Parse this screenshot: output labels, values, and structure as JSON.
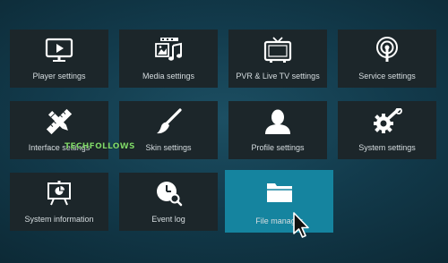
{
  "tiles": [
    {
      "label": "Player settings",
      "icon": "monitor-play-icon"
    },
    {
      "label": "Media settings",
      "icon": "media-icon"
    },
    {
      "label": "PVR & Live TV settings",
      "icon": "tv-icon"
    },
    {
      "label": "Service settings",
      "icon": "broadcast-icon"
    },
    {
      "label": "Interface settings",
      "icon": "pencil-ruler-icon"
    },
    {
      "label": "Skin settings",
      "icon": "paintbrush-icon"
    },
    {
      "label": "Profile settings",
      "icon": "user-icon"
    },
    {
      "label": "System settings",
      "icon": "gear-wrench-icon"
    },
    {
      "label": "System information",
      "icon": "presentation-board-icon"
    },
    {
      "label": "Event log",
      "icon": "clock-search-icon"
    },
    {
      "label": "File manager",
      "icon": "folder-icon",
      "selected": true
    }
  ],
  "watermark": "TECHFOLLOWS",
  "colors": {
    "tile": "#1c262a",
    "selected_tile": "#15849f",
    "text": "#d6dde0",
    "watermark": "#7fd66a"
  }
}
